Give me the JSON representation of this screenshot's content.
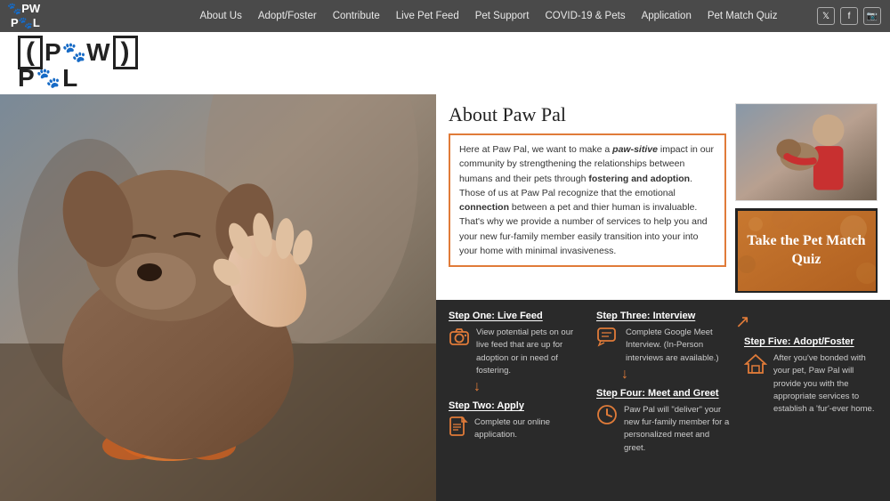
{
  "nav": {
    "links": [
      {
        "label": "About Us",
        "id": "about-us"
      },
      {
        "label": "Adopt/Foster",
        "id": "adopt-foster"
      },
      {
        "label": "Contribute",
        "id": "contribute"
      },
      {
        "label": "Live Pet Feed",
        "id": "live-pet-feed"
      },
      {
        "label": "Pet Support",
        "id": "pet-support"
      },
      {
        "label": "COVID-19 & Pets",
        "id": "covid-pets"
      },
      {
        "label": "Application",
        "id": "application"
      },
      {
        "label": "Pet Match Quiz",
        "id": "pet-match-quiz"
      }
    ],
    "social": [
      "twitter",
      "facebook",
      "instagram"
    ]
  },
  "logo": {
    "top": "PW",
    "bottom": "PAL",
    "brand": "PawPal"
  },
  "about": {
    "title": "About Paw Pal",
    "body_parts": [
      {
        "text": "Here at Paw Pal, we want to make a "
      },
      {
        "text": "paw-sitive",
        "style": "bi"
      },
      {
        "text": " impact in our community by strengthening the relationships between humans and their pets through "
      },
      {
        "text": "fostering and adoption",
        "style": "b"
      },
      {
        "text": ". Those of us at Paw Pal recognize that the emotional "
      },
      {
        "text": "connection",
        "style": "b"
      },
      {
        "text": " between a pet and thier human is invaluable. That's why we provide a number of services to help you and your new fur-family member easily transition into your into your home with minimal invasiveness."
      }
    ]
  },
  "quiz": {
    "label": "Take the Pet Match Quiz"
  },
  "steps": [
    {
      "id": "step1",
      "title": "Step One: Live Feed",
      "icon": "camera",
      "desc": "View potential pets on our live feed that are up for adoption or in need of fostering.",
      "has_arrow_down": true,
      "icon_unicode": "📷"
    },
    {
      "id": "step3",
      "title": "Step Three: Interview",
      "icon": "chat",
      "desc": "Complete Google Meet Interview. (In-Person interviews are available.)",
      "has_arrow_down": true,
      "icon_unicode": "💬"
    },
    {
      "id": "step5",
      "title": "Step Five: Adopt/Foster",
      "icon": "house",
      "desc": "After you've bonded with your pet, Paw Pal will provide you with the appropriate services to establish a 'fur'-ever home.",
      "has_arrow_down": false,
      "icon_unicode": "🏠"
    },
    {
      "id": "step2",
      "title": "Step Two: Apply",
      "icon": "document",
      "desc": "Complete our online application.",
      "has_arrow_down": false,
      "icon_unicode": "📄"
    },
    {
      "id": "step4",
      "title": "Step Four: Meet and Greet",
      "icon": "clock",
      "desc": "Paw Pal will \"deliver\" your new fur-family member for a personalized meet and greet.",
      "has_arrow_down": false,
      "icon_unicode": "🕐"
    }
  ]
}
